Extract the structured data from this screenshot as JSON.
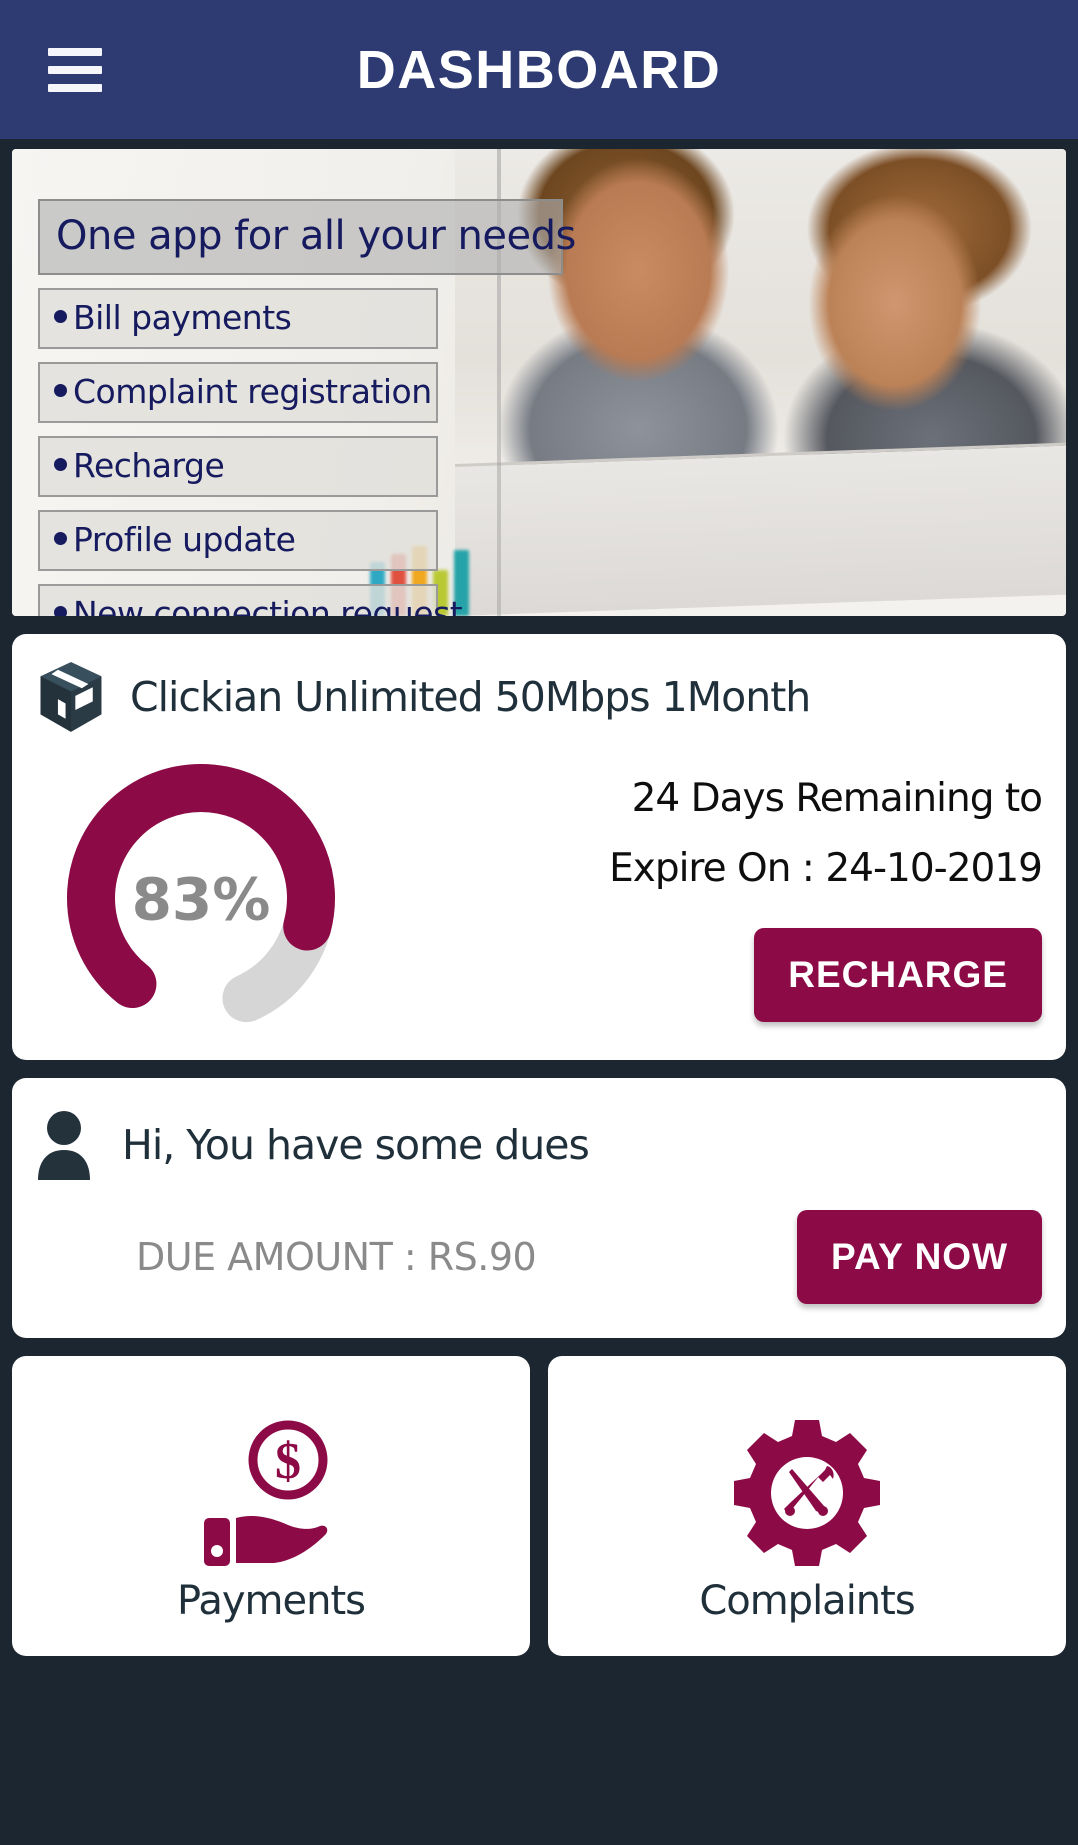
{
  "header": {
    "title": "DASHBOARD",
    "menu_icon": "hamburger-menu-icon",
    "background_color": "#2e3b72"
  },
  "banner": {
    "heading": "One app for all your needs",
    "items": [
      "Bill payments",
      "Complaint registration",
      "Recharge",
      "Profile update",
      "New connection request"
    ]
  },
  "plan_card": {
    "icon": "package-box-icon",
    "title": "Clickian Unlimited 50Mbps 1Month",
    "gauge_percent_label": "83%",
    "gauge_percent_value": 83,
    "days_line_1": "24 Days Remaining to",
    "days_line_2": "Expire On : 24-10-2019",
    "recharge_button": "RECHARGE"
  },
  "dues_card": {
    "icon": "person-icon",
    "title": "Hi, You have some dues",
    "amount_label": "DUE AMOUNT : RS.90",
    "pay_button": "PAY NOW"
  },
  "tiles": [
    {
      "icon": "hand-holding-dollar-icon",
      "label": "Payments"
    },
    {
      "icon": "gear-tools-icon",
      "label": "Complaints"
    }
  ],
  "colors": {
    "brand_maroon": "#8c0a46",
    "header_navy": "#2e3b72",
    "page_background": "#1c2630",
    "text_dark": "#20303b",
    "text_muted": "#8a8a8a"
  }
}
